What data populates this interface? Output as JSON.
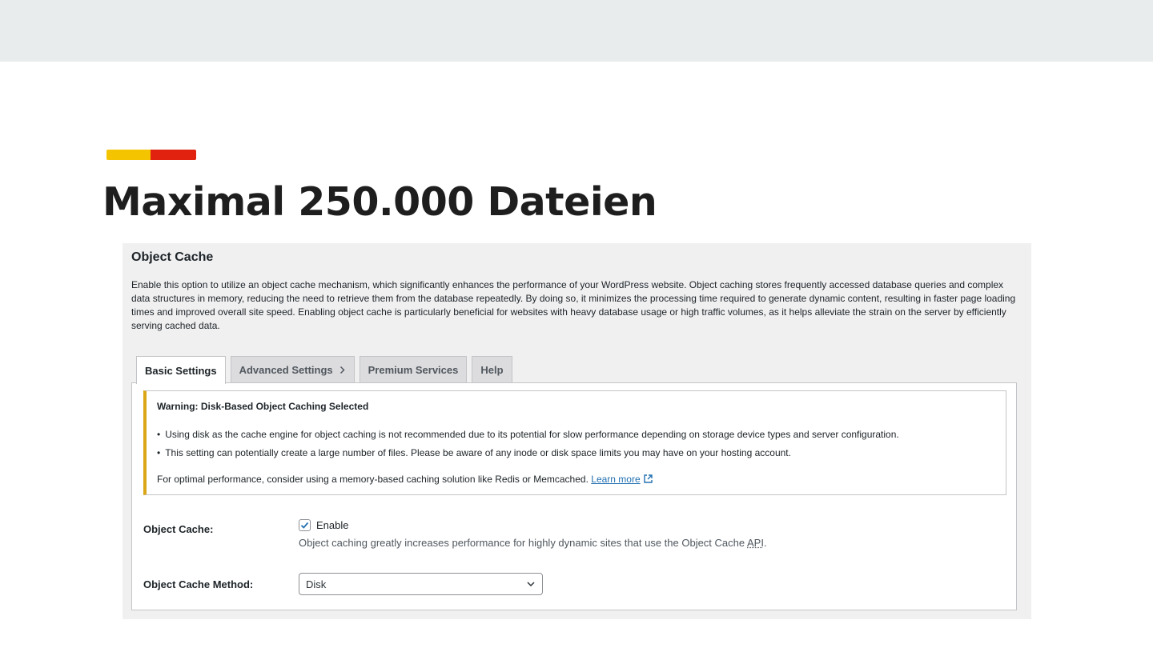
{
  "slide": {
    "title": "Maximal 250.000 Dateien",
    "accent_colors": [
      "#f5c400",
      "#e0220f"
    ]
  },
  "panel": {
    "title": "Object Cache",
    "description": "Enable this option to utilize an object cache mechanism, which significantly enhances the performance of your WordPress website. Object caching stores frequently accessed database queries and complex data structures in memory, reducing the need to retrieve them from the database repeatedly. By doing so, it minimizes the processing time required to generate dynamic content, resulting in faster page loading times and improved overall site speed. Enabling object cache is particularly beneficial for websites with heavy database usage or high traffic volumes, as it helps alleviate the strain on the server by efficiently serving cached data."
  },
  "tabs": [
    {
      "label": "Basic Settings",
      "active": true
    },
    {
      "label": "Advanced Settings",
      "icon": "chevron-right-icon"
    },
    {
      "label": "Premium Services"
    },
    {
      "label": "Help"
    }
  ],
  "notice": {
    "title": "Warning: Disk-Based Object Caching Selected",
    "items": [
      "Using disk as the cache engine for object caching is not recommended due to its potential for slow performance depending on storage device types and server configuration.",
      "This setting can potentially create a large number of files. Please be aware of any inode or disk space limits you may have on your hosting account."
    ],
    "footer_text": "For optimal performance, consider using a memory-based caching solution like Redis or Memcached.",
    "learn_more": "Learn more",
    "link_icon": "external-link-icon",
    "border_color": "#dba617"
  },
  "form": {
    "object_cache_label": "Object Cache:",
    "enable_label": "Enable",
    "enable_checked": true,
    "desc_prefix": "Object caching greatly increases performance for highly dynamic sites that use the Object Cache",
    "desc_abbr": "API",
    "desc_suffix": ".",
    "method_label": "Object Cache Method:",
    "method_value": "Disk"
  }
}
